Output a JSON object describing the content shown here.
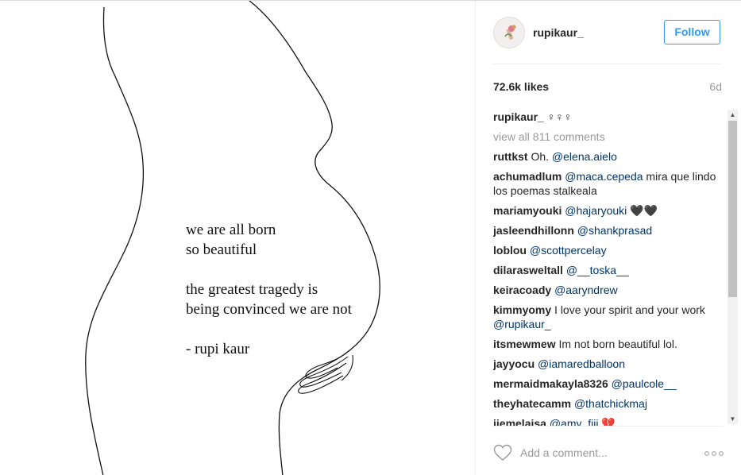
{
  "poem": {
    "line1": "we are all born",
    "line2": "so beautiful",
    "line3": "the greatest tragedy is",
    "line4": "being convinced we are not",
    "signature": "- rupi kaur"
  },
  "post": {
    "username": "rupikaur_",
    "follow_label": "Follow",
    "likes": "72.6k likes",
    "time_ago": "6d",
    "add_comment_placeholder": "Add a comment...",
    "more_icon": "ellipsis-icon",
    "like_icon": "heart-outline-icon"
  },
  "caption": {
    "user": "rupikaur_",
    "text": "♀♀♀"
  },
  "view_all": "view all 811 comments",
  "comments": [
    {
      "user": "ruttkst",
      "pre": "Oh. ",
      "mention": "@elena.aielo",
      "post": ""
    },
    {
      "user": "achumadlum",
      "pre": "",
      "mention": "@maca.cepeda",
      "post": " mira que lindo los poemas stalkeala"
    },
    {
      "user": "mariamyouki",
      "pre": "",
      "mention": "@hajaryouki",
      "post": " 🖤🖤"
    },
    {
      "user": "jasleendhillonn",
      "pre": "",
      "mention": "@shankprasad",
      "post": ""
    },
    {
      "user": "loblou",
      "pre": "",
      "mention": "@scottpercelay",
      "post": ""
    },
    {
      "user": "dilarasweltall",
      "pre": "",
      "mention": "@__toska__",
      "post": ""
    },
    {
      "user": "keiracoady",
      "pre": "",
      "mention": "@aaryndrew",
      "post": ""
    },
    {
      "user": "kimmyomy",
      "pre": "I love your spirit and your work ",
      "mention": "@rupikaur_",
      "post": ""
    },
    {
      "user": "itsmewmew",
      "pre": "Im not born beautiful lol.",
      "mention": "",
      "post": ""
    },
    {
      "user": "jayyocu",
      "pre": "",
      "mention": "@iamaredballoon",
      "post": ""
    },
    {
      "user": "mermaidmakayla8326",
      "pre": "",
      "mention": "@paulcole__",
      "post": ""
    },
    {
      "user": "theyhatecamm",
      "pre": "",
      "mention": "@thatchickmaj",
      "post": ""
    },
    {
      "user": "jjemelaisa",
      "pre": "",
      "mention": "@amy_fiji",
      "post": " 💔"
    }
  ],
  "colors": {
    "follow_blue": "#3897f0",
    "mention_blue": "#003569",
    "muted_gray": "#999999"
  }
}
